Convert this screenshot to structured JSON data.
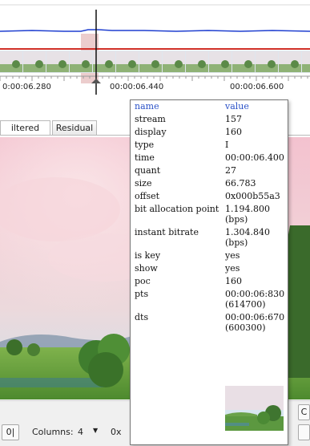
{
  "timeline": {
    "time_ticks": [
      "0:00:06.280",
      "00:00:06.440",
      "00:00:06.600"
    ]
  },
  "tabs": [
    {
      "label": "iltered"
    },
    {
      "label": "Residual"
    }
  ],
  "statusbar": {
    "left_button_label": "0|",
    "columns_label": "Columns:",
    "columns_value": "4",
    "columns_dropdown_glyph": "▼",
    "checkbox_label": "0x",
    "right_button_label": "C"
  },
  "popup": {
    "header": {
      "name": "name",
      "value": "value"
    },
    "rows": [
      {
        "name": "stream",
        "value": "157"
      },
      {
        "name": "display",
        "value": "160"
      },
      {
        "name": "type",
        "value": "I"
      },
      {
        "name": "time",
        "value": "00:00:06.400"
      },
      {
        "name": "quant",
        "value": "27"
      },
      {
        "name": "size",
        "value": "66.783"
      },
      {
        "name": "offset",
        "value": "0x000b55a3"
      },
      {
        "name": "bit allocation point",
        "value": "1.194.800 (bps)"
      },
      {
        "name": "instant bitrate",
        "value": "1.304.840 (bps)"
      },
      {
        "name": "is key",
        "value": "yes"
      },
      {
        "name": "show",
        "value": "yes"
      },
      {
        "name": "poc",
        "value": "160"
      },
      {
        "name": "pts",
        "value": "00:00:06:830 (614700)"
      },
      {
        "name": "dts",
        "value": "00:00:06:670 (600300)"
      }
    ]
  },
  "colors": {
    "bitrate_line": "#1f3fd0",
    "quant_line": "#d03028",
    "selection": "#e8b4b4",
    "header_text": "#2b52c8"
  }
}
